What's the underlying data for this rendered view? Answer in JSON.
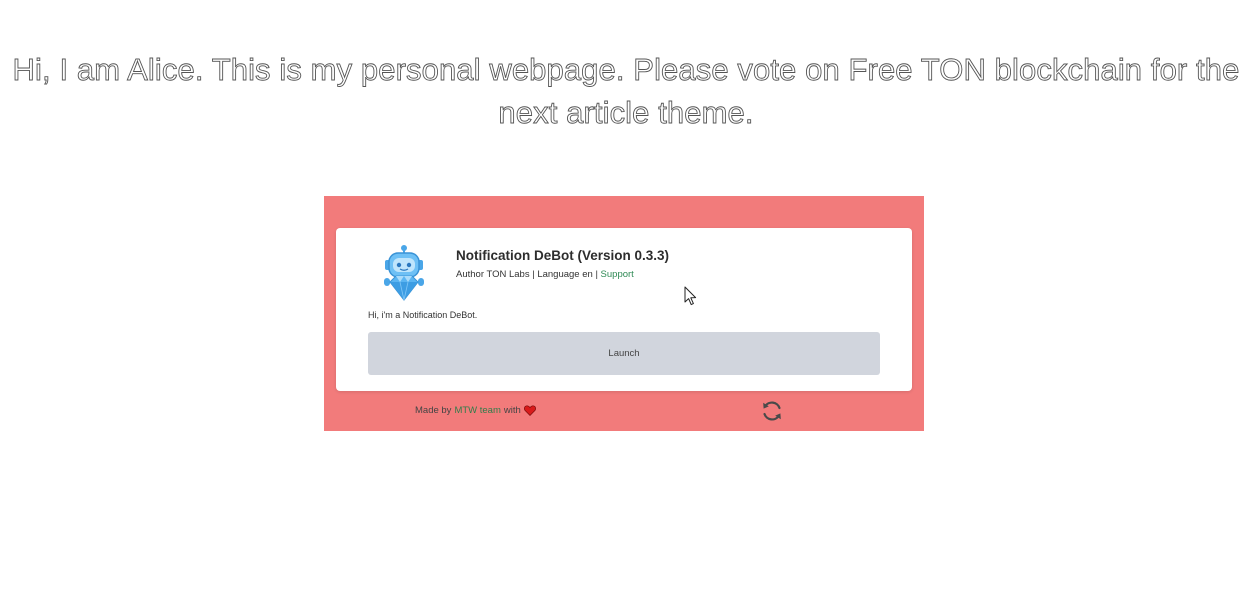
{
  "headline": {
    "line1": "Hi, I am Alice. This is my personal webpage. Please vote on Free TON blockchain for the",
    "line2": "next article theme."
  },
  "debot": {
    "avatar_icon": "robot-diamond-icon",
    "title": "Notification DeBot (Version 0.3.3)",
    "meta_text": "Author TON Labs | Language en | ",
    "support_label": "Support",
    "greeting": "Hi, i'm a Notification DeBot.",
    "launch_label": "Launch"
  },
  "footer": {
    "made_by": "Made by",
    "team_label": "MTW team",
    "with": "with",
    "heart_icon": "heart-icon",
    "refresh_icon": "refresh-icon"
  },
  "colors": {
    "widget_background": "#f27b7b",
    "launch_button": "#d1d5dd",
    "link_green": "#2f8a55",
    "heart_red": "#d81b1b"
  }
}
